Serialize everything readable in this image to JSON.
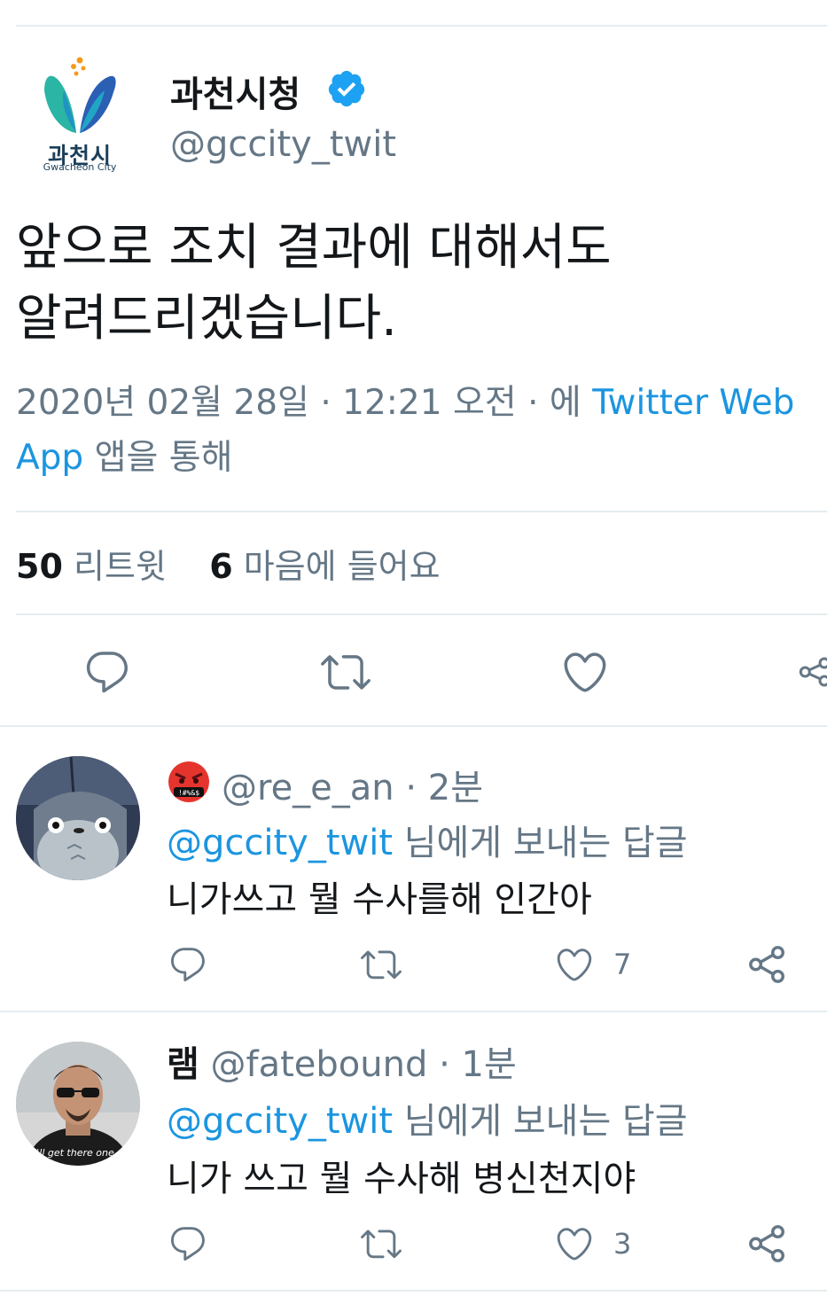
{
  "tweet": {
    "author": {
      "name": "과천시청",
      "handle": "@gccity_twit",
      "logo_text_ko": "과천시",
      "logo_text_en": "Gwacheon City",
      "verified": true
    },
    "text_line1": "앞으로 조치 결과에 대해서도",
    "text_line2": "알려드리겠습니다.",
    "meta": {
      "date": "2020년 02월 28일",
      "sep1": " · ",
      "time": "12:21 오전",
      "sep2": " · 에 ",
      "source": "Twitter Web App",
      "suffix": " 앱을 통해"
    },
    "stats": {
      "retweets_count": "50",
      "retweets_label": "리트윗",
      "likes_count": "6",
      "likes_label": "마음에 들어요"
    },
    "actions": [
      "reply-icon",
      "retweet-icon",
      "like-icon",
      "share-icon"
    ]
  },
  "replies": [
    {
      "emoji": "cursing-face-emoji",
      "handle": "@re_e_an",
      "time": " · 2분",
      "reply_to_handle": "@gccity_twit",
      "reply_to_suffix": " 님에게 보내는 답글",
      "text": "니가쓰고 뭘 수사를해 인간아",
      "like_count": "7"
    },
    {
      "name": "램",
      "handle": "@fatebound",
      "time": " · 1분",
      "reply_to_handle": "@gccity_twit",
      "reply_to_suffix": " 님에게 보내는 답글",
      "text": "니가 쓰고 뭘 수사해 병신천지야",
      "like_count": "3",
      "avatar_caption": "I'll get there one d"
    }
  ],
  "colors": {
    "link": "#1b95e0",
    "secondary": "#657786",
    "primary_text": "#14171a",
    "divider": "#e6ecf0"
  }
}
